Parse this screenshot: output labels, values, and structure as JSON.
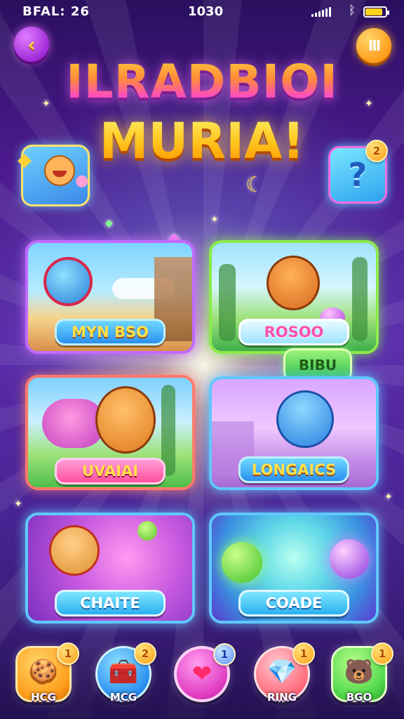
{
  "status_bar": {
    "left_text": "BFAL: 26",
    "time": "1030",
    "battery_color": "#ffd21a"
  },
  "header": {
    "back_icon": "back-arrow-icon",
    "pause_icon": "pause-icon",
    "title_line1": "ILRADBIOI",
    "title_line2": "MURIA!",
    "help_badge": "2",
    "help_symbol": "?"
  },
  "cards": [
    {
      "label": "MYN BSO",
      "label_style": "blue",
      "border": "#c06bff"
    },
    {
      "label": "ROSOO",
      "label_style": "light",
      "border": "#8bea4a"
    },
    {
      "label": "UVAIAI",
      "label_style": "pink",
      "border": "#ff7a6a"
    },
    {
      "label": "LONGAICS",
      "label_style": "blue",
      "border": "#5fc8ff"
    },
    {
      "label": "CHAITE",
      "label_style": "cyan",
      "border": "#5fc8ff"
    },
    {
      "label": "COADE",
      "label_style": "cyan",
      "border": "#5fc8ff"
    }
  ],
  "floating_tag": "BIBU",
  "bottom_nav": [
    {
      "label": "HCG",
      "badge": "1",
      "icon": "cookie-icon",
      "color": "#ffb02e"
    },
    {
      "label": "MCG",
      "badge": "2",
      "icon": "treasure-chest-icon",
      "color": "#3fa6ff"
    },
    {
      "label": "",
      "badge": "1",
      "icon": "heart-icon",
      "color": "#ff3fae"
    },
    {
      "label": "RING",
      "badge": "1",
      "icon": "crystal-icon",
      "color": "#ff6a7a"
    },
    {
      "label": "BGO",
      "badge": "1",
      "icon": "bear-icon",
      "color": "#4fd84a"
    }
  ]
}
